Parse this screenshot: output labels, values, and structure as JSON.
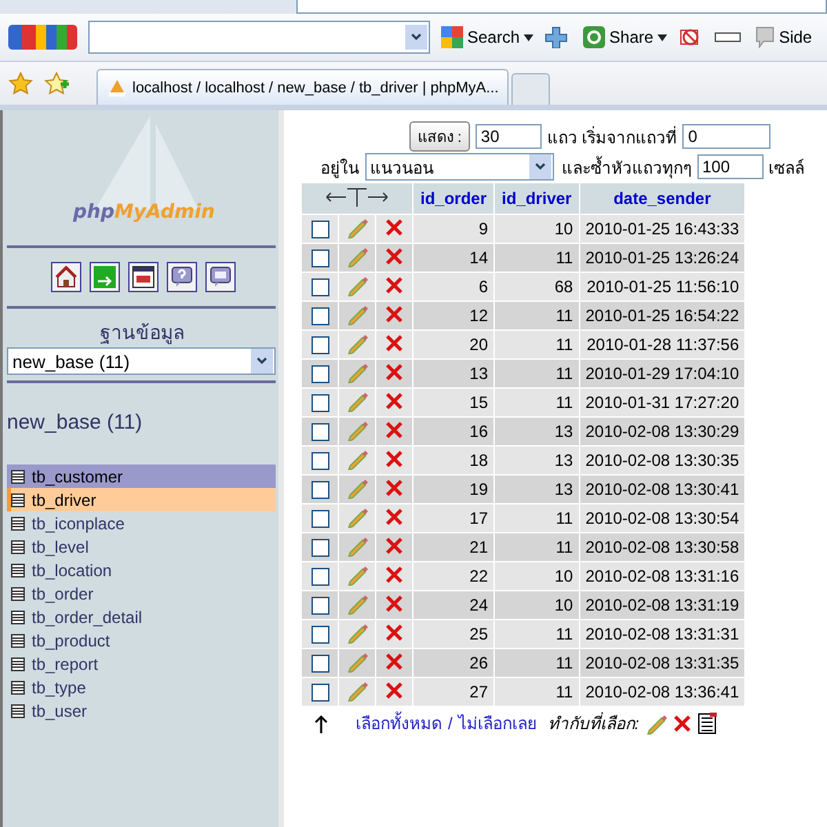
{
  "google_toolbar": {
    "search_button": "Search",
    "share_button": "Share",
    "sidebar_button": "Side"
  },
  "browser_tab": {
    "title": "localhost / localhost / new_base / tb_driver | phpMyA..."
  },
  "sidebar": {
    "logo_php": "php",
    "logo_myadmin": "MyAdmin",
    "database_label": "ฐานข้อมูล",
    "database_select": "new_base (11)",
    "database_title": "new_base (11)",
    "tables": [
      {
        "name": "tb_customer",
        "selected": false,
        "hover": true
      },
      {
        "name": "tb_driver",
        "selected": true,
        "hover": false
      },
      {
        "name": "tb_iconplace",
        "selected": false,
        "hover": false
      },
      {
        "name": "tb_level",
        "selected": false,
        "hover": false
      },
      {
        "name": "tb_location",
        "selected": false,
        "hover": false
      },
      {
        "name": "tb_order",
        "selected": false,
        "hover": false
      },
      {
        "name": "tb_order_detail",
        "selected": false,
        "hover": false
      },
      {
        "name": "tb_product",
        "selected": false,
        "hover": false
      },
      {
        "name": "tb_report",
        "selected": false,
        "hover": false
      },
      {
        "name": "tb_type",
        "selected": false,
        "hover": false
      },
      {
        "name": "tb_user",
        "selected": false,
        "hover": false
      }
    ]
  },
  "navigation": {
    "show_button": "แสดง :",
    "rows_value": "30",
    "rows_label": "แถว เริ่มจากแถวที่",
    "start_value": "0",
    "mode_label": "อยู่ใน",
    "mode_select": "แนวนอน",
    "repeat_label": "และซ้ำหัวแถวทุกๆ",
    "repeat_value": "100",
    "cells_label": "เซลล์"
  },
  "table": {
    "columns": [
      "id_order",
      "id_driver",
      "date_sender"
    ],
    "rows": [
      {
        "id_order": "9",
        "id_driver": "10",
        "date_sender": "2010-01-25 16:43:33",
        "checked": false
      },
      {
        "id_order": "14",
        "id_driver": "11",
        "date_sender": "2010-01-25 13:26:24",
        "checked": false
      },
      {
        "id_order": "6",
        "id_driver": "68",
        "date_sender": "2010-01-25 11:56:10",
        "checked": false
      },
      {
        "id_order": "12",
        "id_driver": "11",
        "date_sender": "2010-01-25 16:54:22",
        "checked": false
      },
      {
        "id_order": "20",
        "id_driver": "11",
        "date_sender": "2010-01-28 11:37:56",
        "checked": false
      },
      {
        "id_order": "13",
        "id_driver": "11",
        "date_sender": "2010-01-29 17:04:10",
        "checked": false
      },
      {
        "id_order": "15",
        "id_driver": "11",
        "date_sender": "2010-01-31 17:27:20",
        "checked": false
      },
      {
        "id_order": "16",
        "id_driver": "13",
        "date_sender": "2010-02-08 13:30:29",
        "checked": false
      },
      {
        "id_order": "18",
        "id_driver": "13",
        "date_sender": "2010-02-08 13:30:35",
        "checked": false
      },
      {
        "id_order": "19",
        "id_driver": "13",
        "date_sender": "2010-02-08 13:30:41",
        "checked": false
      },
      {
        "id_order": "17",
        "id_driver": "11",
        "date_sender": "2010-02-08 13:30:54",
        "checked": false
      },
      {
        "id_order": "21",
        "id_driver": "11",
        "date_sender": "2010-02-08 13:30:58",
        "checked": false
      },
      {
        "id_order": "22",
        "id_driver": "10",
        "date_sender": "2010-02-08 13:31:16",
        "checked": false
      },
      {
        "id_order": "24",
        "id_driver": "10",
        "date_sender": "2010-02-08 13:31:19",
        "checked": false
      },
      {
        "id_order": "25",
        "id_driver": "11",
        "date_sender": "2010-02-08 13:31:31",
        "checked": false
      },
      {
        "id_order": "26",
        "id_driver": "11",
        "date_sender": "2010-02-08 13:31:35",
        "checked": false
      },
      {
        "id_order": "27",
        "id_driver": "11",
        "date_sender": "2010-02-08 13:36:41",
        "checked": false
      }
    ]
  },
  "footer": {
    "select_all": "เลือกทั้งหมด",
    "separator": "/",
    "select_none": "ไม่เลือกเลย",
    "with_selected": "ทำกับที่เลือก:"
  }
}
